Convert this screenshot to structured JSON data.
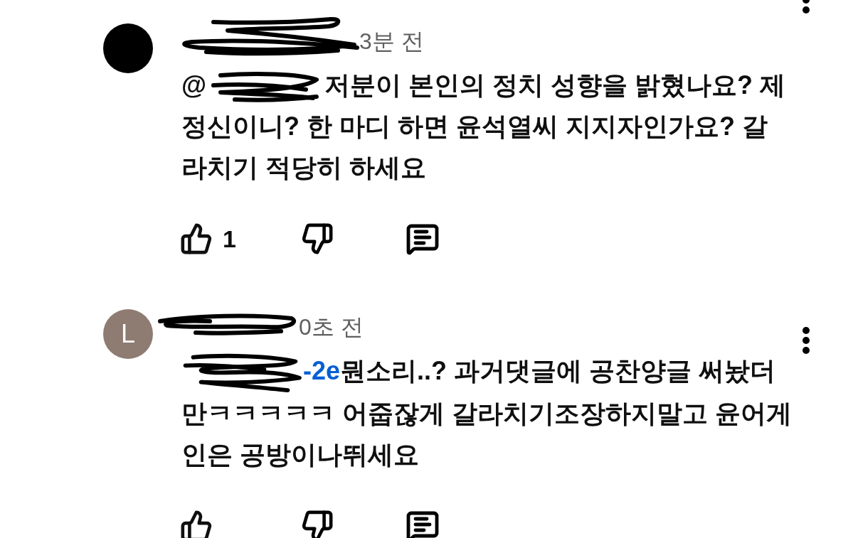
{
  "comments": [
    {
      "avatar": {
        "kind": "plain",
        "color": "#000000"
      },
      "time": "3분 전",
      "mention": {
        "text": "@",
        "linked": false
      },
      "lines": [
        "저분이 본인의 정치 성향을 밝혔나요? 제",
        "정신이니? 한 마디 하면 윤석열씨 지지자인가요? 갈",
        "라치기 적당히 하세요"
      ],
      "likes": "1",
      "menu": false
    },
    {
      "avatar": {
        "kind": "letter",
        "letter": "L",
        "color": "#8e7b72"
      },
      "time": "0초 전",
      "mention": {
        "text": "-2e",
        "linked": true
      },
      "lines": [
        "뭔소리..? 과거댓글에 공찬양글 써놨더",
        "만ㅋㅋㅋㅋㅋ 어줍잖게 갈라치기조장하지말고 윤어게",
        "인은 공방이나뛰세요"
      ],
      "menu": true
    }
  ]
}
